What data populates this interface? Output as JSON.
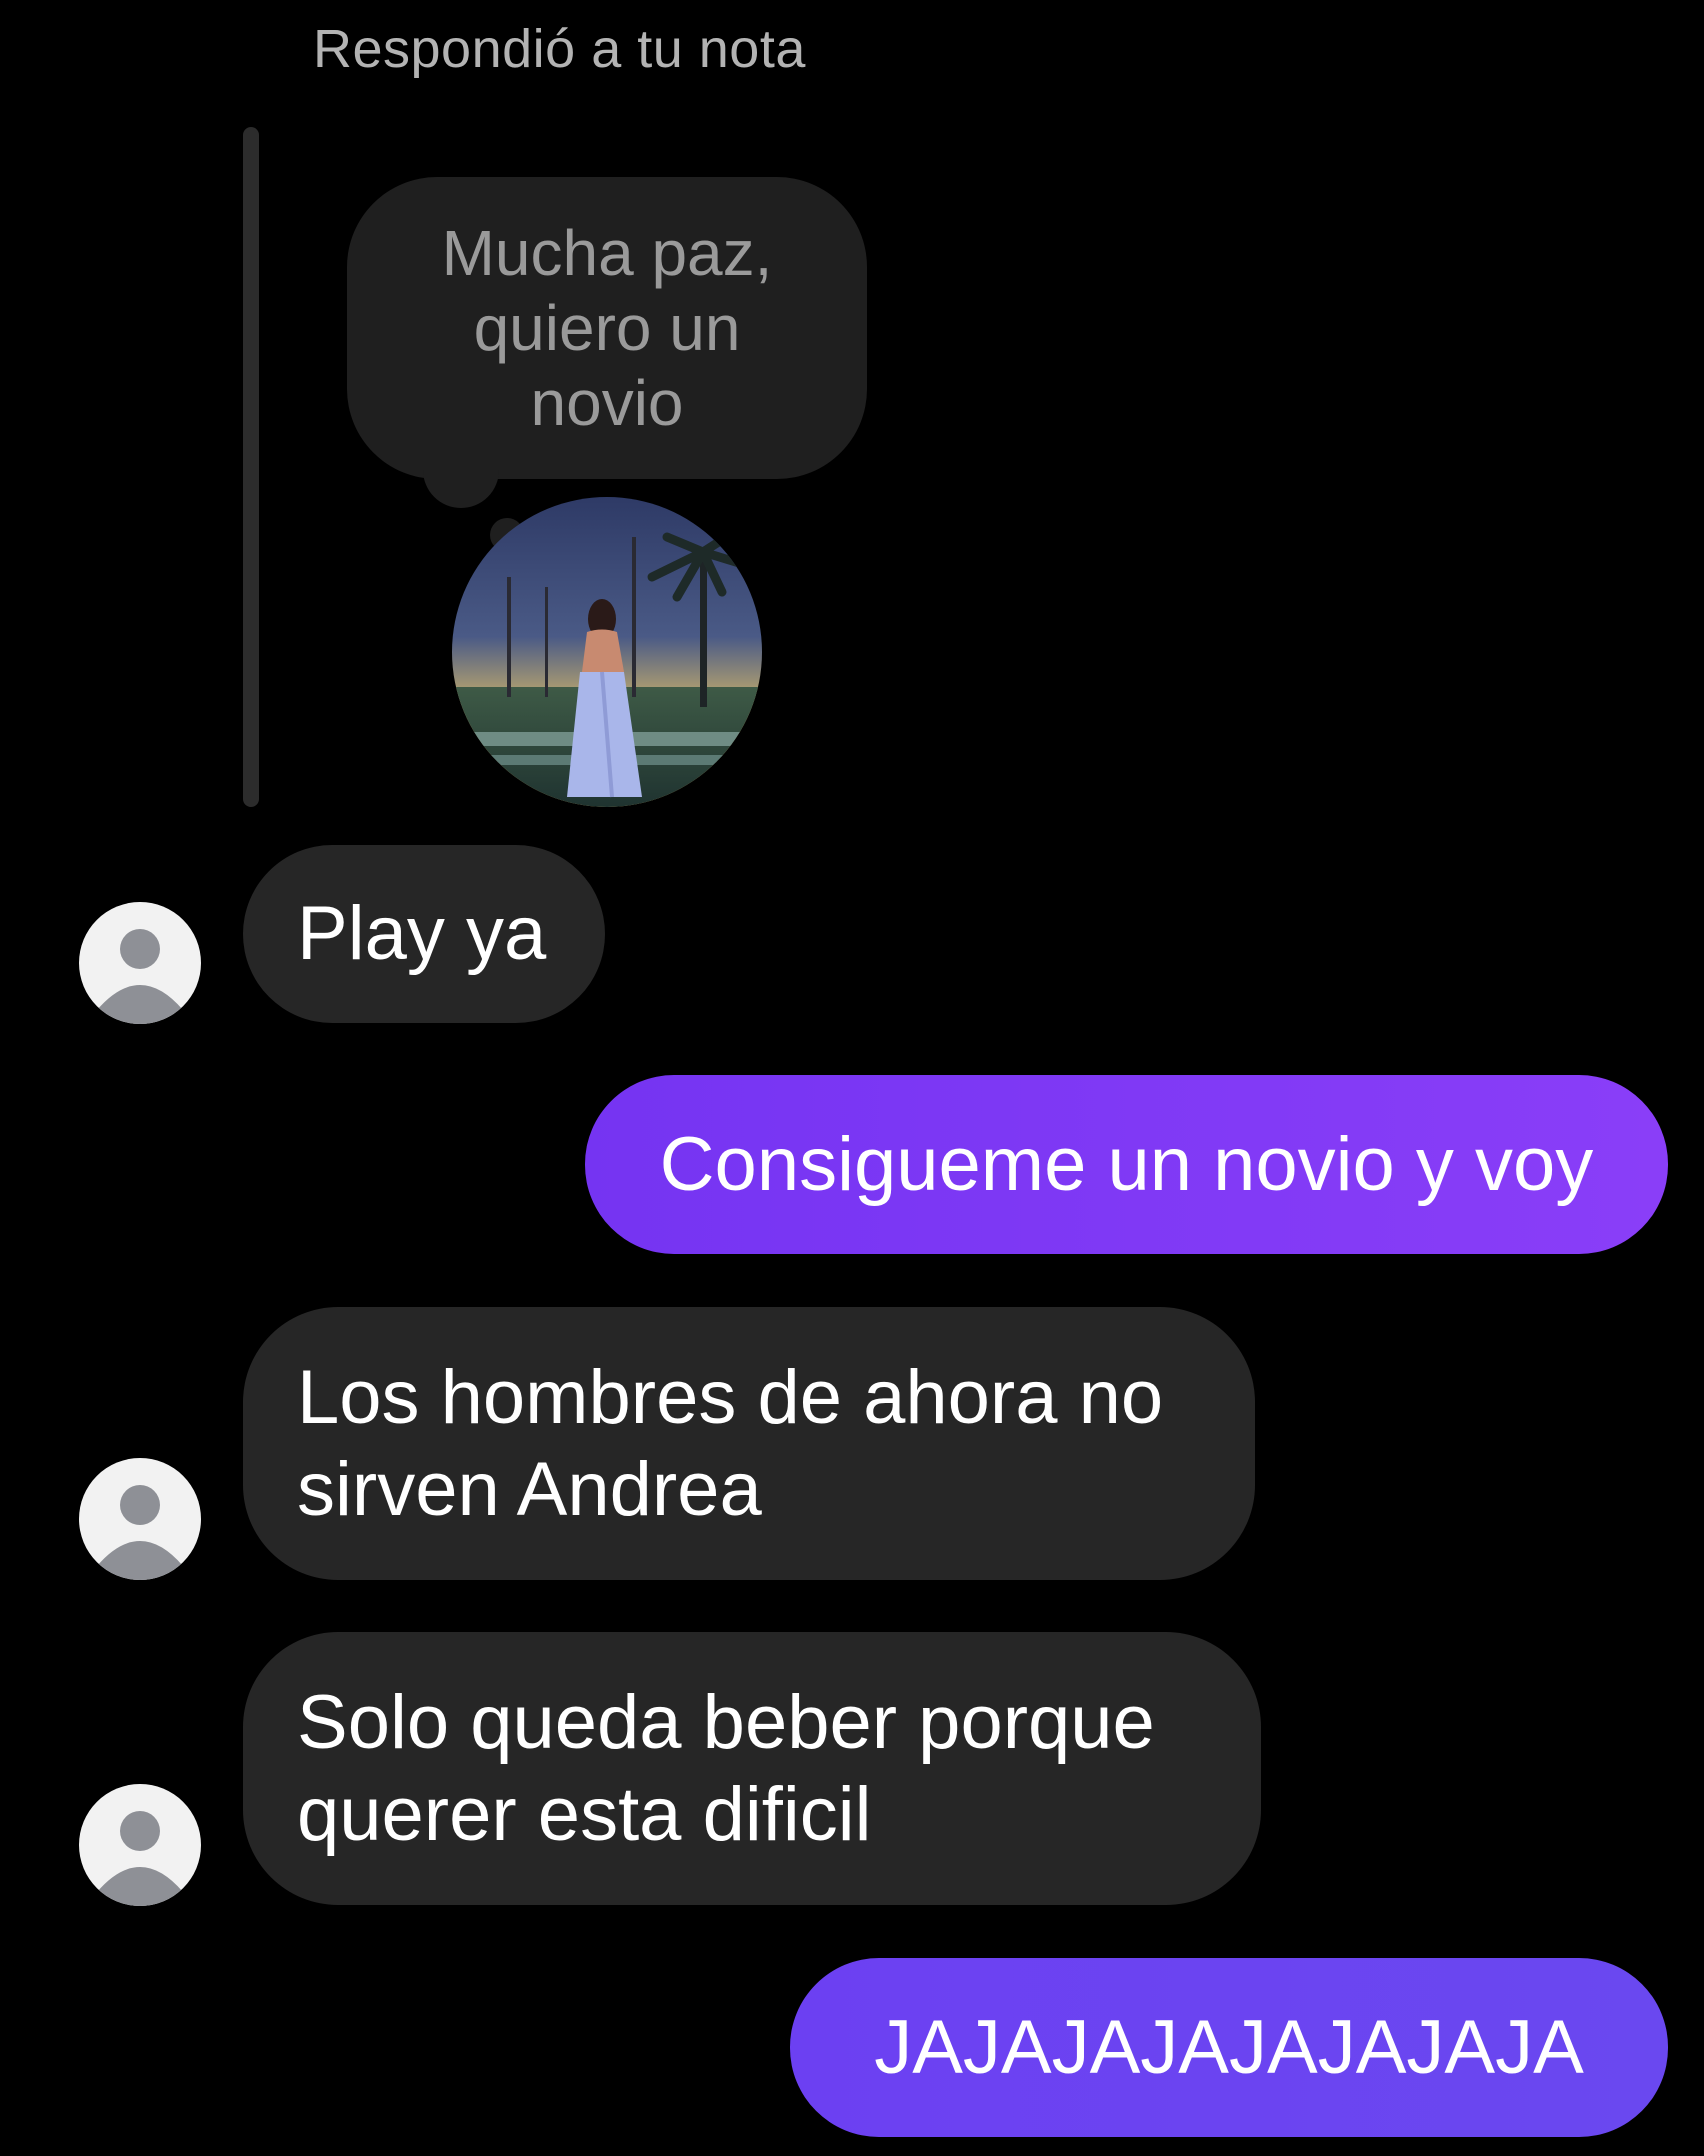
{
  "reply_header": "Respondió a tu nota",
  "note": {
    "text": "Mucha paz,\nquiero un\nnovio"
  },
  "messages": [
    {
      "direction": "incoming",
      "text": "Play ya"
    },
    {
      "direction": "outgoing",
      "text": "Consigueme un novio y voy"
    },
    {
      "direction": "incoming",
      "text": "Los hombres de ahora no\nsirven Andrea"
    },
    {
      "direction": "incoming",
      "text": "Solo queda beber porque\nquerer esta dificil"
    },
    {
      "direction": "outgoing",
      "text": "JAJAJAJAJAJAJAJA"
    }
  ],
  "colors": {
    "background": "#000000",
    "incoming_bubble": "#262626",
    "outgoing_bubble": "#7b39f5",
    "note_bubble": "#1f1f1f",
    "avatar_bg": "#f2f2f2",
    "avatar_figure": "#8e9096"
  },
  "icons": {
    "avatar": "default-user-avatar-icon"
  }
}
